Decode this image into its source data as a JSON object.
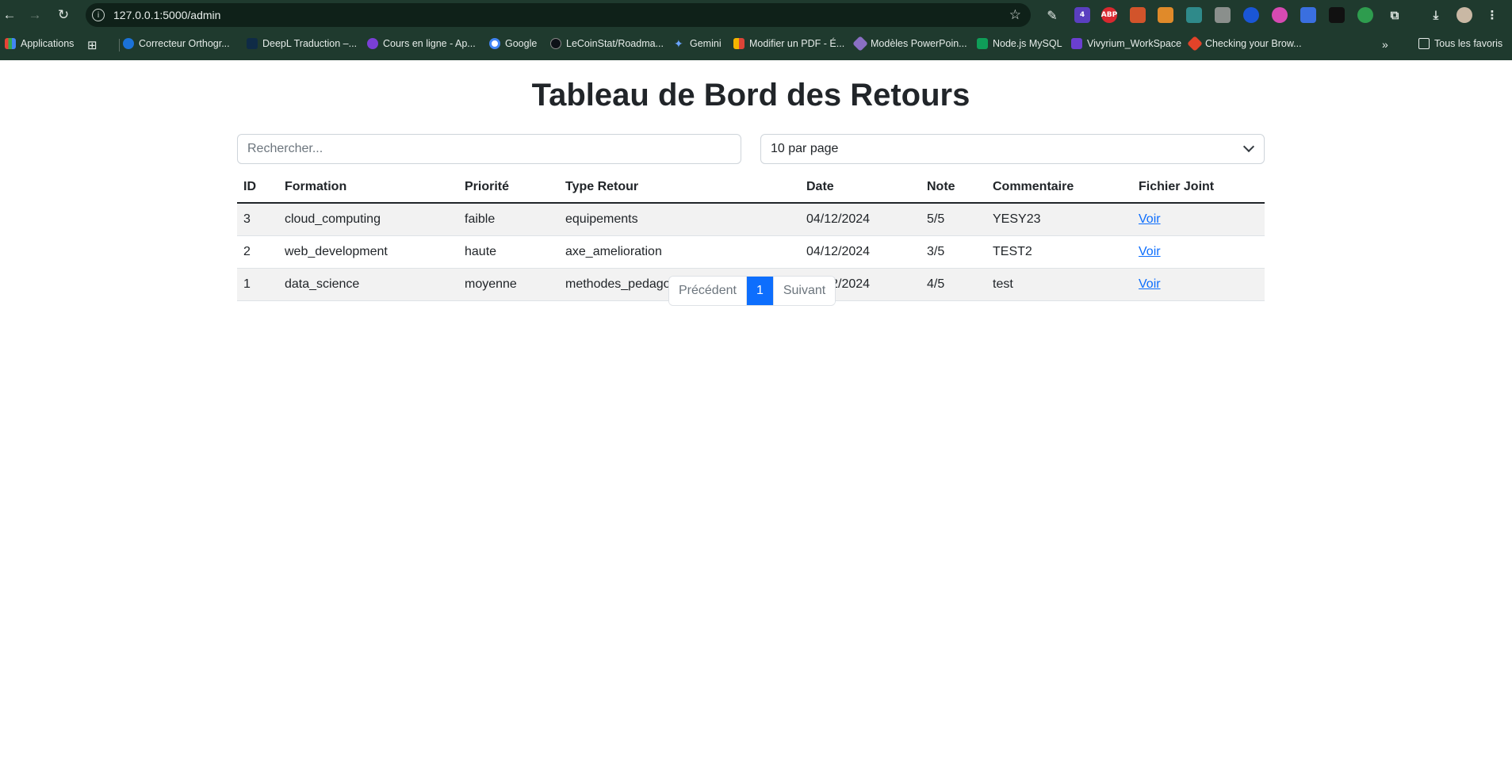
{
  "browser": {
    "url": "127.0.0.1:5000/admin",
    "extension_badge": "4",
    "abp_label": "ABP",
    "bookmarks": [
      "Applications",
      "Correcteur Orthogr...",
      "DeepL Traduction –...",
      "Cours en ligne - Ap...",
      "Google",
      "LeCoinStat/Roadma...",
      "Gemini",
      "Modifier un PDF - É...",
      "Modèles PowerPoin...",
      "Node.js MySQL",
      "Vivyrium_WorkSpace",
      "Checking your Brow..."
    ],
    "all_bookmarks": "Tous les favoris"
  },
  "page": {
    "title": "Tableau de Bord des Retours",
    "search_placeholder": "Rechercher...",
    "per_page": "10 par page"
  },
  "table": {
    "headers": [
      "ID",
      "Formation",
      "Priorité",
      "Type Retour",
      "Date",
      "Note",
      "Commentaire",
      "Fichier Joint"
    ],
    "rows": [
      [
        "3",
        "cloud_computing",
        "faible",
        "equipements",
        "04/12/2024",
        "5/5",
        "YESY23",
        "Voir"
      ],
      [
        "2",
        "web_development",
        "haute",
        "axe_amelioration",
        "04/12/2024",
        "3/5",
        "TEST2",
        "Voir"
      ],
      [
        "1",
        "data_science",
        "moyenne",
        "methodes_pedagogiques",
        "04/12/2024",
        "4/5",
        "test",
        "Voir"
      ]
    ]
  },
  "pagination": {
    "prev": "Précédent",
    "current": "1",
    "next": "Suivant"
  }
}
